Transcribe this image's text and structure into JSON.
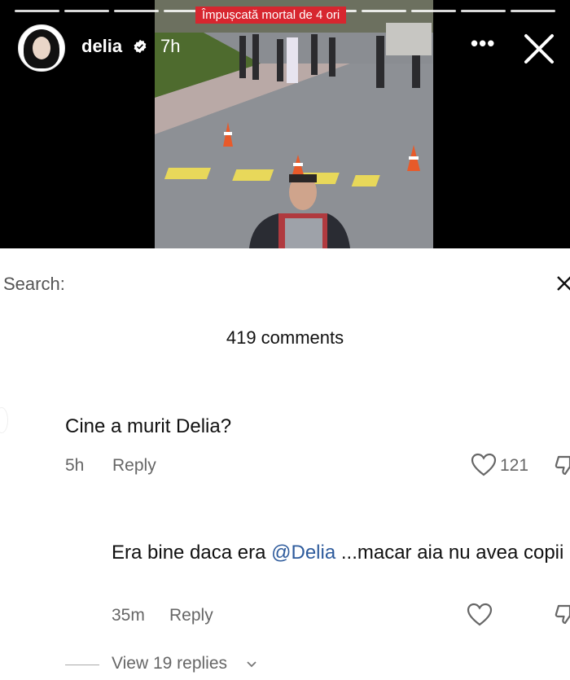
{
  "story": {
    "overlay_text": "Împușcată mortal de 4 ori",
    "username": "delia",
    "time_ago": "7h",
    "more_label": "•••",
    "progress_segments": 11
  },
  "search": {
    "label": "Search:"
  },
  "comments_count": "419 comments",
  "comments": [
    {
      "text": "Cine a murit Delia?",
      "time": "5h",
      "reply_label": "Reply",
      "likes": "121"
    },
    {
      "text_before": "Era bine daca era ",
      "mention": "@Delia",
      "text_after": " ...macar aia nu avea copii",
      "time": "35m",
      "reply_label": "Reply",
      "view_replies": "View 19 replies"
    }
  ],
  "icons": {
    "verified": "verified-badge-icon",
    "close": "close-icon",
    "heart": "heart-icon",
    "dislike": "thumbs-down-icon",
    "chevron": "chevron-down-icon"
  },
  "colors": {
    "mention": "#2e5b9c",
    "overlay_bg": "#d7262f"
  }
}
